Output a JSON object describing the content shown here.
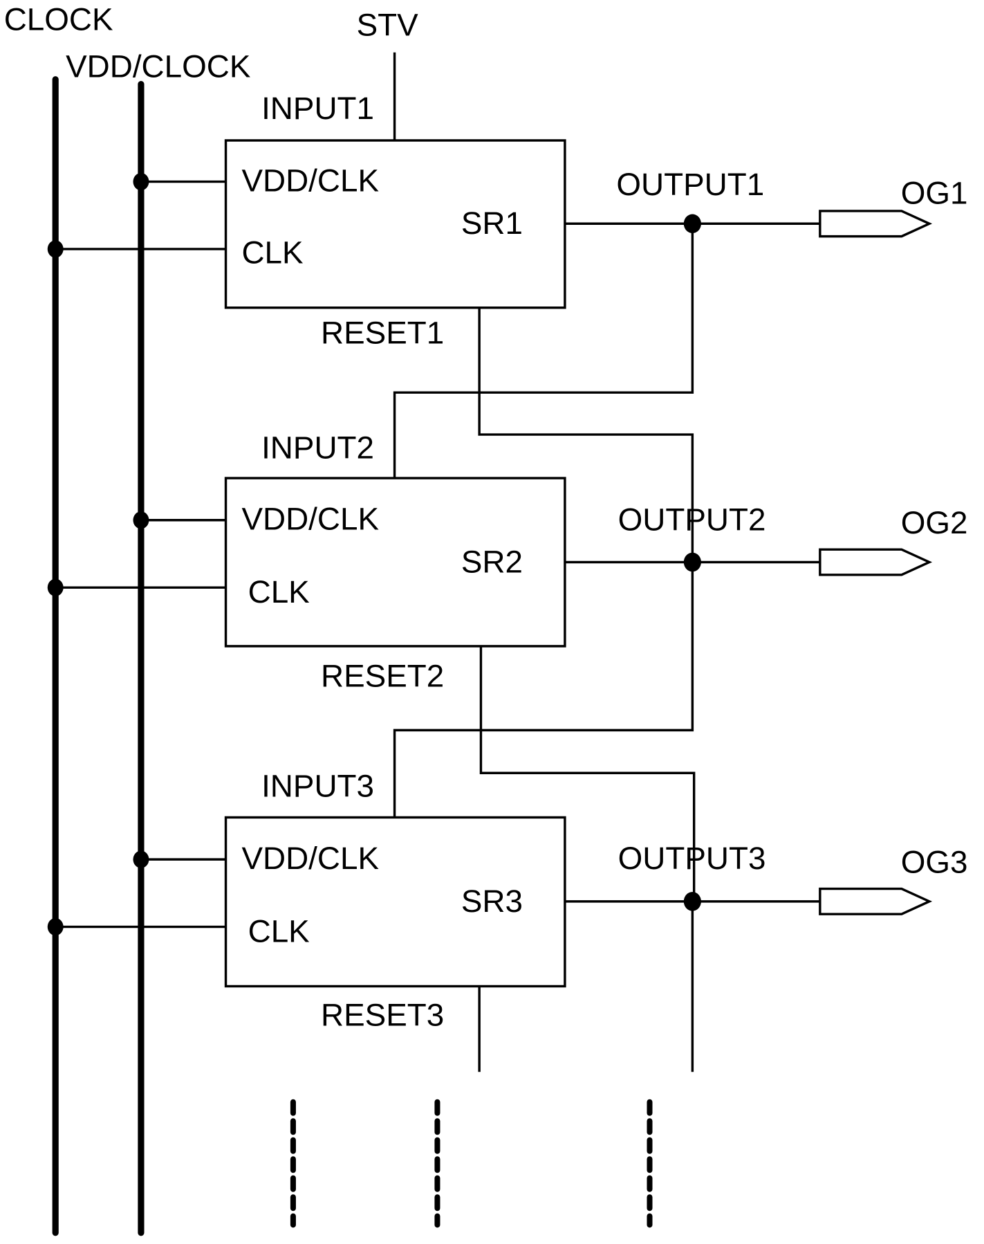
{
  "buses": {
    "clock_label": "CLOCK",
    "vdd_clock_label": "VDD/CLOCK",
    "stv_label": "STV"
  },
  "stages": [
    {
      "name": "SR1",
      "input": "INPUT1",
      "vdd_clk": "VDD/CLK",
      "clk": "CLK",
      "reset": "RESET1",
      "output": "OUTPUT1",
      "og": "OG1"
    },
    {
      "name": "SR2",
      "input": "INPUT2",
      "vdd_clk": "VDD/CLK",
      "clk": "CLK",
      "reset": "RESET2",
      "output": "OUTPUT2",
      "og": "OG2"
    },
    {
      "name": "SR3",
      "input": "INPUT3",
      "vdd_clk": "VDD/CLK",
      "clk": "CLK",
      "reset": "RESET3",
      "output": "OUTPUT3",
      "og": "OG3"
    }
  ],
  "continuation": "ellipsis-vertical"
}
